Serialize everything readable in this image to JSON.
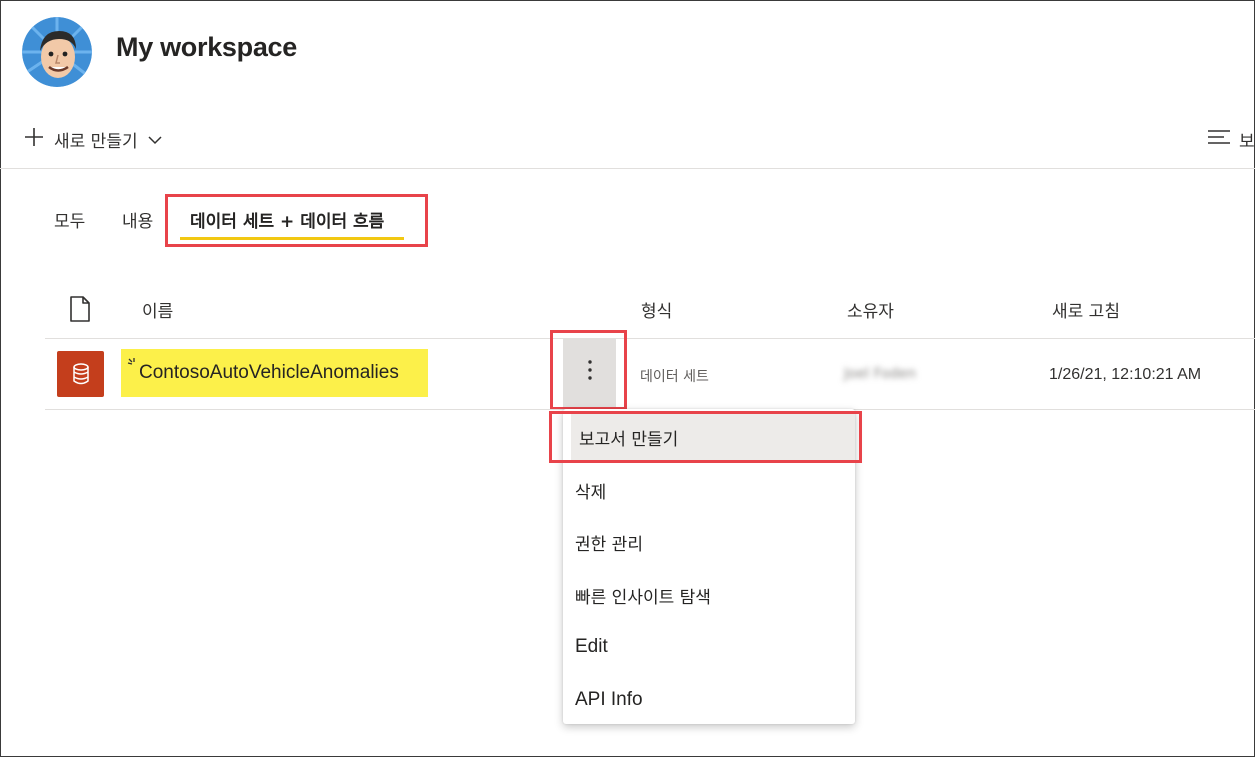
{
  "workspace": {
    "title": "My workspace"
  },
  "toolbar": {
    "new_label": "새로 만들기",
    "view_label": "보"
  },
  "tabs": [
    {
      "label": "모두"
    },
    {
      "label": "내용"
    },
    {
      "label": "데이터 세트 + 데이터 흐름",
      "active": true
    }
  ],
  "table": {
    "headers": {
      "name": "이름",
      "type": "형식",
      "owner": "소유자",
      "refreshed": "새로 고침"
    },
    "rows": [
      {
        "name": "ContosoAutoVehicleAnomalies",
        "type": "데이터 세트",
        "owner": "Joel Foden",
        "refreshed": "1/26/21, 12:10:21 AM",
        "icon": "dataset-icon"
      }
    ]
  },
  "context_menu": {
    "items": [
      {
        "label": "보고서 만들기",
        "highlighted": true
      },
      {
        "label": "삭제"
      },
      {
        "label": "권한 관리"
      },
      {
        "label": "빠른 인사이트 탐색"
      },
      {
        "label": "Edit"
      },
      {
        "label": "API Info"
      }
    ]
  },
  "colors": {
    "dataset_icon_bg": "#c43e1c",
    "tab_underline": "#f2c811",
    "annotation_box": "#e8434a",
    "name_highlight": "#fcf04a"
  }
}
